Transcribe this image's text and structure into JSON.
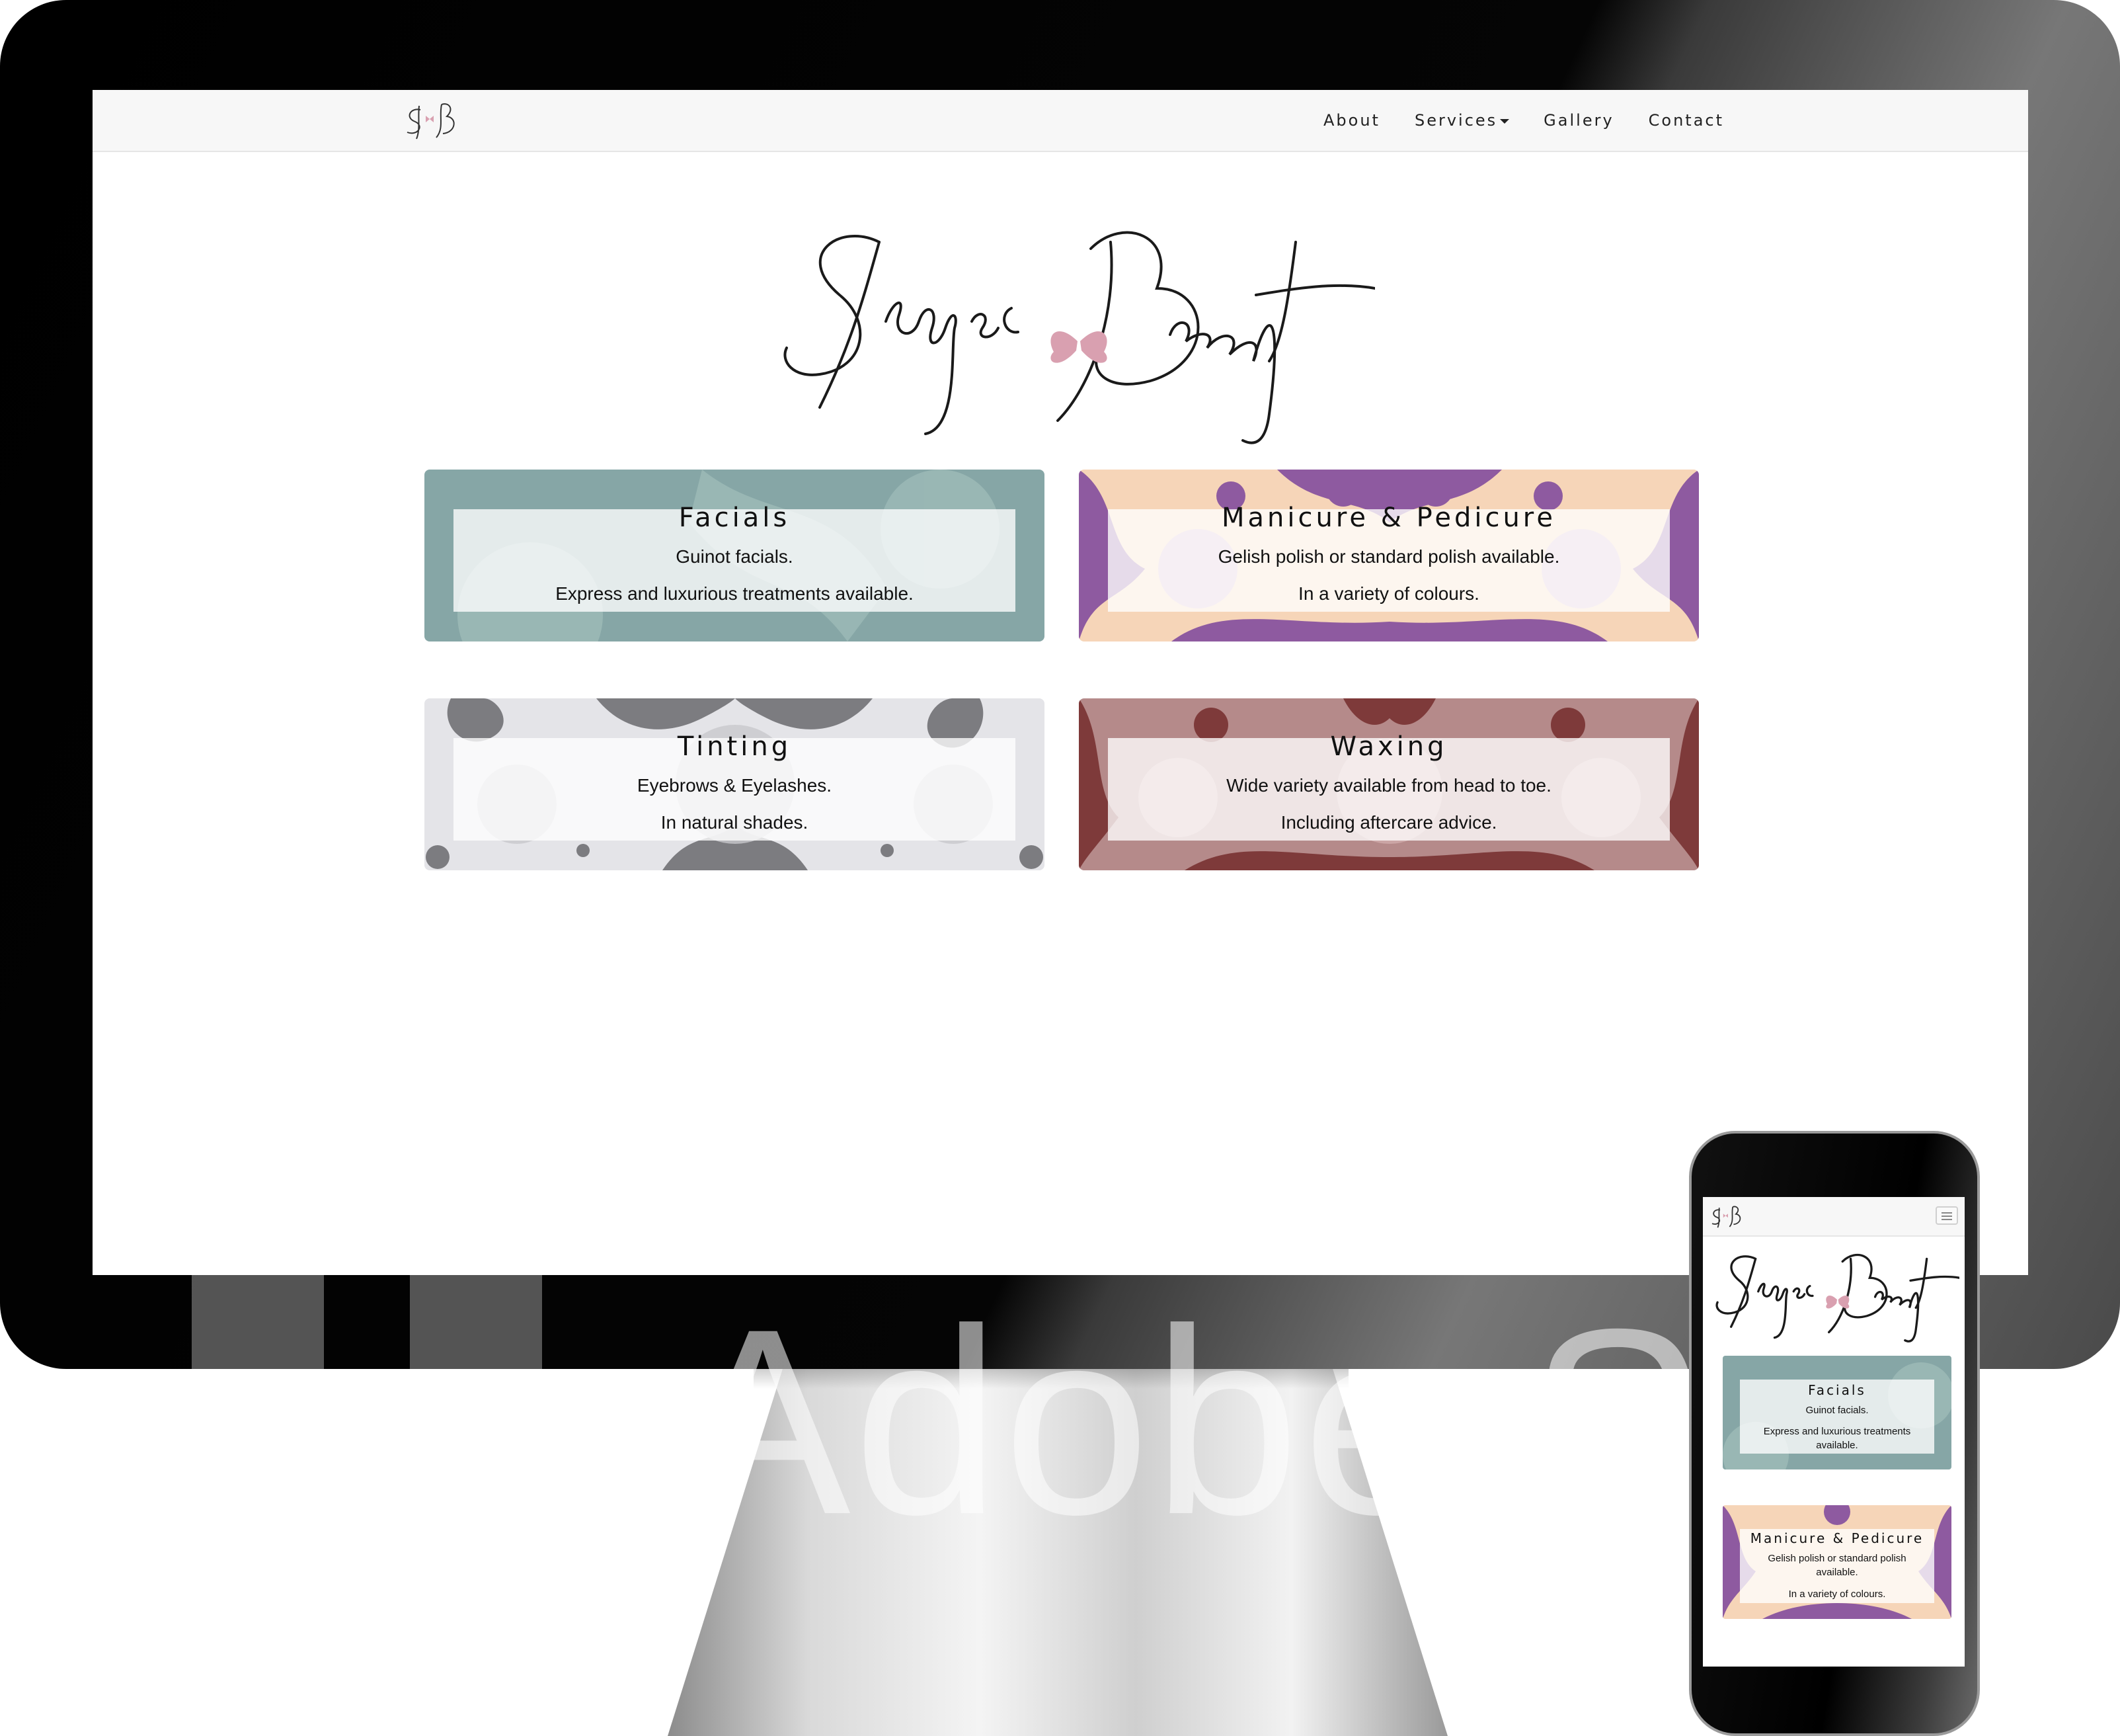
{
  "site": {
    "nav_logo_text": "SB",
    "brand_name": "Skye's Beauty",
    "colors": {
      "navbar_bg": "#f7f7f7",
      "accent_butterfly": "#d9a0b0",
      "facials": "#86a6a6",
      "manicure_bg": "#f6d5b8",
      "manicure_pattern": "#8e5aa0",
      "tinting_bg": "#e4e4e8",
      "tinting_pattern": "#7c7c80",
      "waxing": "#b58a8a",
      "waxing_pattern": "#7e3a3a"
    }
  },
  "nav": {
    "items": [
      {
        "label": "About"
      },
      {
        "label": "Services",
        "has_dropdown": true
      },
      {
        "label": "Gallery"
      },
      {
        "label": "Contact"
      }
    ]
  },
  "services": [
    {
      "title": "Facials",
      "line1": "Guinot facials.",
      "line2": "Express and luxurious treatments available."
    },
    {
      "title": "Manicure & Pedicure",
      "line1": "Gelish polish or standard polish available.",
      "line2": "In a variety of colours."
    },
    {
      "title": "Tinting",
      "line1": "Eyebrows & Eyelashes.",
      "line2": "In natural shades."
    },
    {
      "title": "Waxing",
      "line1": "Wide variety available from head to toe.",
      "line2": "Including aftercare advice."
    }
  ],
  "mobile": {
    "facials": {
      "title": "Facials",
      "line1": "Guinot facials.",
      "line2a": "Express and luxurious treatments",
      "line2b": "available."
    },
    "manicure": {
      "title": "Manicure & Pedicure",
      "line1a": "Gelish polish or standard polish",
      "line1b": "available.",
      "line2": "In a variety of colours."
    }
  },
  "watermark": "Adobe St"
}
